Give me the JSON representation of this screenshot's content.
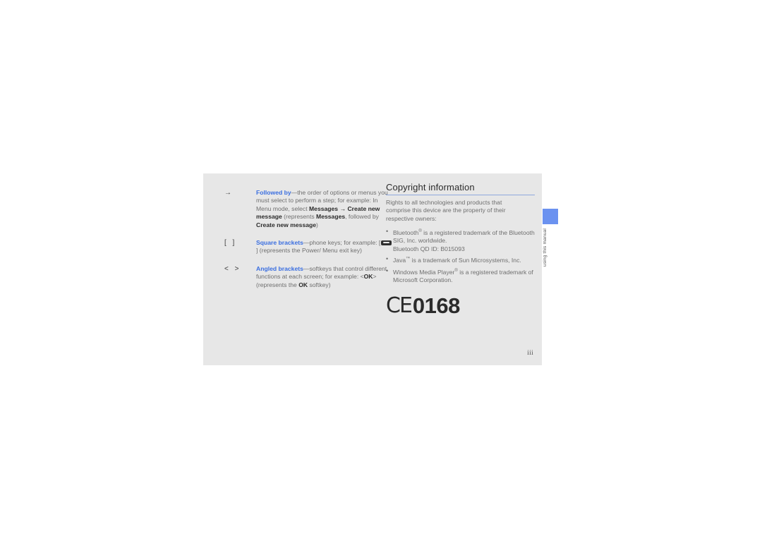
{
  "page": {
    "folio": "iii",
    "side_tab": {
      "label": "using this manual",
      "swatch_color": "#6b92f0"
    }
  },
  "conventions": [
    {
      "symbol": "→",
      "term": "Followed by",
      "dash": "—",
      "text_1": "the order of options or menus you must select to perform a step; for example: In Menu mode, select ",
      "bold_1": "Messages",
      "inline_arrow": " → ",
      "bold_2": "Create new message",
      "text_2": " (represents ",
      "bold_3": "Messages",
      "text_3": ", followed by ",
      "bold_4": "Create new message",
      "text_4": ")"
    },
    {
      "symbol": "[  ]",
      "term": "Square brackets",
      "dash": "—",
      "text_1": "phone keys; for example: [",
      "key_icon": "power-menu-exit-key-icon",
      "text_2": "] (represents the Power/ Menu exit key)"
    },
    {
      "symbol": "<  >",
      "term": "Angled brackets",
      "dash": "—",
      "text_1": "softkeys that control different functions at each screen; for example: <",
      "bold_1": "OK",
      "text_2": "> (represents the ",
      "bold_2": "OK",
      "text_3": " softkey)"
    }
  ],
  "copyright": {
    "heading": "Copyright information",
    "intro": "Rights to all technologies and products that comprise this device are the property of their respective owners:",
    "bullets": [
      {
        "pre": "Bluetooth",
        "sup": "®",
        "post": " is a registered trademark of the Bluetooth SIG, Inc. worldwide.",
        "extra": "Bluetooth QD ID: B015093"
      },
      {
        "pre": "Java",
        "sup": "™",
        "post": " is a trademark of Sun Microsystems, Inc.",
        "extra": ""
      },
      {
        "pre": "Windows Media Player",
        "sup": "®",
        "post": " is a registered trademark of Microsoft Corporation.",
        "extra": ""
      }
    ],
    "ce_mark": {
      "letters": "CE",
      "number": "0168"
    }
  }
}
